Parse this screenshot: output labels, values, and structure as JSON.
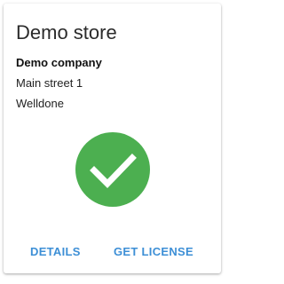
{
  "store": {
    "title": "Demo store",
    "company": "Demo company",
    "address_lines": [
      "Main street 1",
      "Welldone"
    ]
  },
  "status": {
    "icon": "check-circle-icon",
    "color": "#4caf50"
  },
  "actions": {
    "details_label": "DETAILS",
    "license_label": "GET LICENSE",
    "accent_color": "#3d8fd6"
  }
}
